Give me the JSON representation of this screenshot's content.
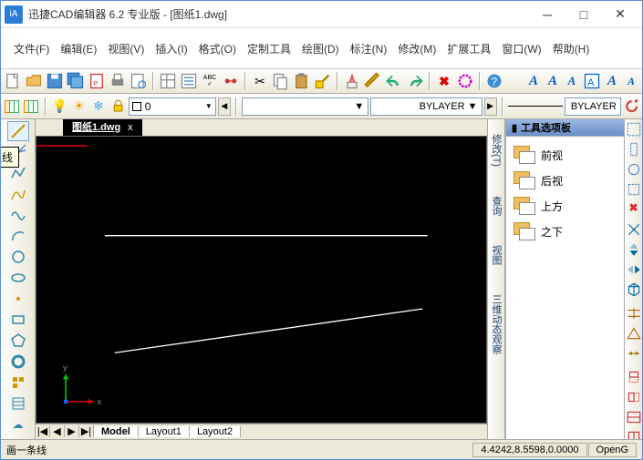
{
  "title": "迅捷CAD编辑器 6.2 专业版  -  [图纸1.dwg]",
  "app_icon_text": "iA",
  "menus": [
    "文件(F)",
    "编辑(E)",
    "视图(V)",
    "插入(I)",
    "格式(O)",
    "定制工具",
    "绘图(D)",
    "标注(N)",
    "修改(M)",
    "扩展工具",
    "窗口(W)",
    "帮助(H)"
  ],
  "toolbar2": {
    "combo_bylayer1": "BYLAYER",
    "combo_bylayer2": "BYLAYER"
  },
  "doc_tab": {
    "name": "图纸1.dwg",
    "close": "x"
  },
  "tooltip": "直线",
  "axes": {
    "x": "x",
    "y": "y"
  },
  "layout_tabs": {
    "nav": [
      "|◀",
      "◀",
      "▶",
      "▶|"
    ],
    "tabs": [
      "Model",
      "Layout1",
      "Layout2"
    ]
  },
  "side_strip": [
    "修改(T)",
    "查询",
    "视图",
    "三维动态观察"
  ],
  "panel": {
    "title": "工具选项板",
    "items": [
      "前视",
      "后视",
      "上方",
      "之下"
    ]
  },
  "status": {
    "left": "画一条线",
    "coords": "4.4242,8.5598,0.0000",
    "renderer": "OpenG"
  }
}
